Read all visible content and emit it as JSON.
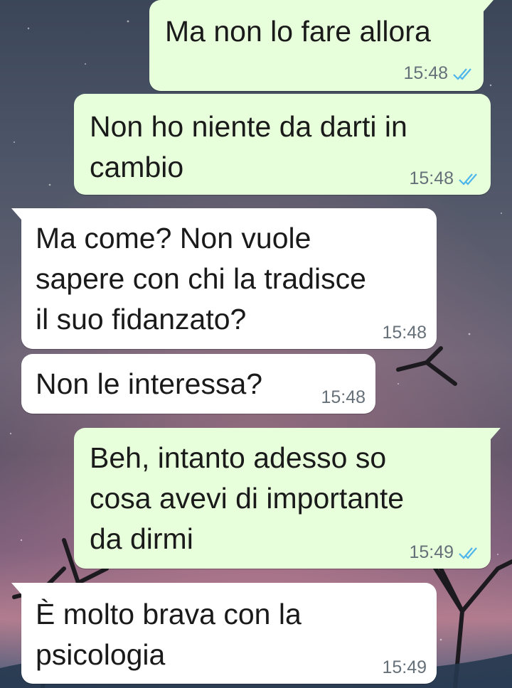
{
  "colors": {
    "outgoing_bubble": "#e7ffdb",
    "incoming_bubble": "#ffffff",
    "read_ticks": "#4fb6ec",
    "timestamp": "#667079"
  },
  "messages": [
    {
      "direction": "outgoing",
      "text": "Ma non lo fare allora",
      "time": "15:48",
      "status": "read",
      "status_icon": "double-check-icon"
    },
    {
      "direction": "outgoing",
      "text": "Non ho niente da darti in\ncambio",
      "time": "15:48",
      "status": "read",
      "status_icon": "double-check-icon"
    },
    {
      "direction": "incoming",
      "text": "Ma come? Non vuole\nsapere con chi la tradisce\nil suo fidanzato?",
      "time": "15:48"
    },
    {
      "direction": "incoming",
      "text": "Non le interessa?",
      "time": "15:48"
    },
    {
      "direction": "outgoing",
      "text": "Beh, intanto adesso so\ncosa avevi di importante\nda dirmi",
      "time": "15:49",
      "status": "read",
      "status_icon": "double-check-icon"
    },
    {
      "direction": "incoming",
      "text": "È molto brava con la\npsicologia",
      "time": "15:49"
    }
  ]
}
